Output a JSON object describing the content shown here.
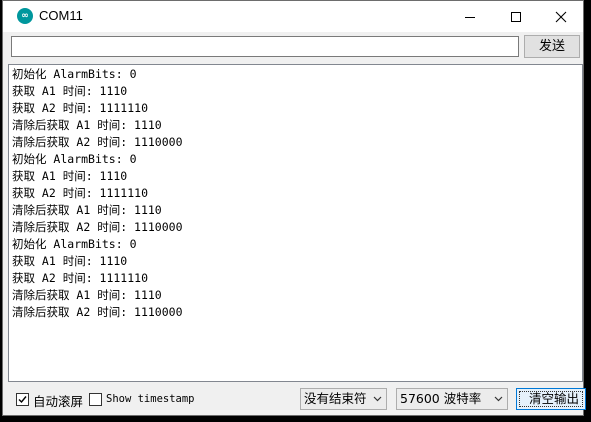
{
  "window": {
    "title": "COM11",
    "icon": "arduino-icon",
    "controls": [
      "minimize-icon",
      "maximize-icon",
      "close-icon"
    ]
  },
  "send": {
    "input_value": "",
    "button_label": "发送"
  },
  "output": {
    "lines": [
      "初始化 AlarmBits: 0",
      "获取 A1 时间: 1110",
      "获取 A2 时间: 1111110",
      "清除后获取 A1 时间: 1110",
      "清除后获取 A2 时间: 1110000",
      "初始化 AlarmBits: 0",
      "获取 A1 时间: 1110",
      "获取 A2 时间: 1111110",
      "清除后获取 A1 时间: 1110",
      "清除后获取 A2 时间: 1110000",
      "初始化 AlarmBits: 0",
      "获取 A1 时间: 1110",
      "获取 A2 时间: 1111110",
      "清除后获取 A1 时间: 1110",
      "清除后获取 A2 时间: 1110000"
    ]
  },
  "footer": {
    "autoscroll": {
      "label": "自动滚屏",
      "checked": true
    },
    "timestamp": {
      "label": "Show timestamp",
      "checked": false
    },
    "line_ending": {
      "value": "没有结束符"
    },
    "baud_rate": {
      "value": "57600 波特率"
    },
    "clear_button": "清空输出"
  }
}
